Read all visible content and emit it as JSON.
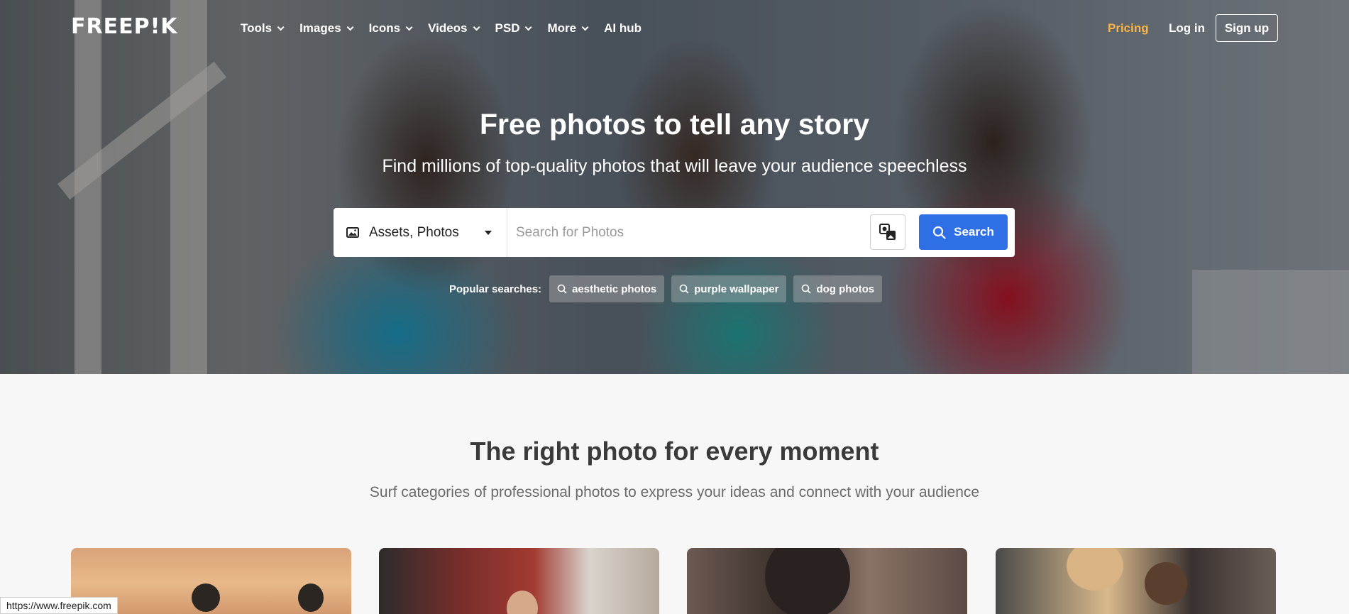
{
  "nav": {
    "logo": "FREEP!K",
    "items": [
      {
        "label": "Tools",
        "has_dropdown": true
      },
      {
        "label": "Images",
        "has_dropdown": true
      },
      {
        "label": "Icons",
        "has_dropdown": true
      },
      {
        "label": "Videos",
        "has_dropdown": true
      },
      {
        "label": "PSD",
        "has_dropdown": true
      },
      {
        "label": "More",
        "has_dropdown": true
      },
      {
        "label": "AI hub",
        "has_dropdown": false
      }
    ],
    "pricing": "Pricing",
    "login": "Log in",
    "signup": "Sign up"
  },
  "hero": {
    "title": "Free photos to tell any story",
    "subtitle": "Find millions of top-quality photos that will leave your audience speechless"
  },
  "search": {
    "asset_type": "Assets, Photos",
    "placeholder": "Search for Photos",
    "value": "",
    "button": "Search"
  },
  "popular": {
    "label": "Popular searches:",
    "items": [
      "aesthetic photos",
      "purple wallpaper",
      "dog photos"
    ]
  },
  "section": {
    "title": "The right photo for every moment",
    "subtitle": "Surf categories of professional photos to express your ideas and connect with your audience"
  },
  "status_url": "https://www.freepik.com",
  "colors": {
    "accent": "#2e6fe6",
    "pricing": "#f7b547",
    "background": "#f7f7f7"
  }
}
